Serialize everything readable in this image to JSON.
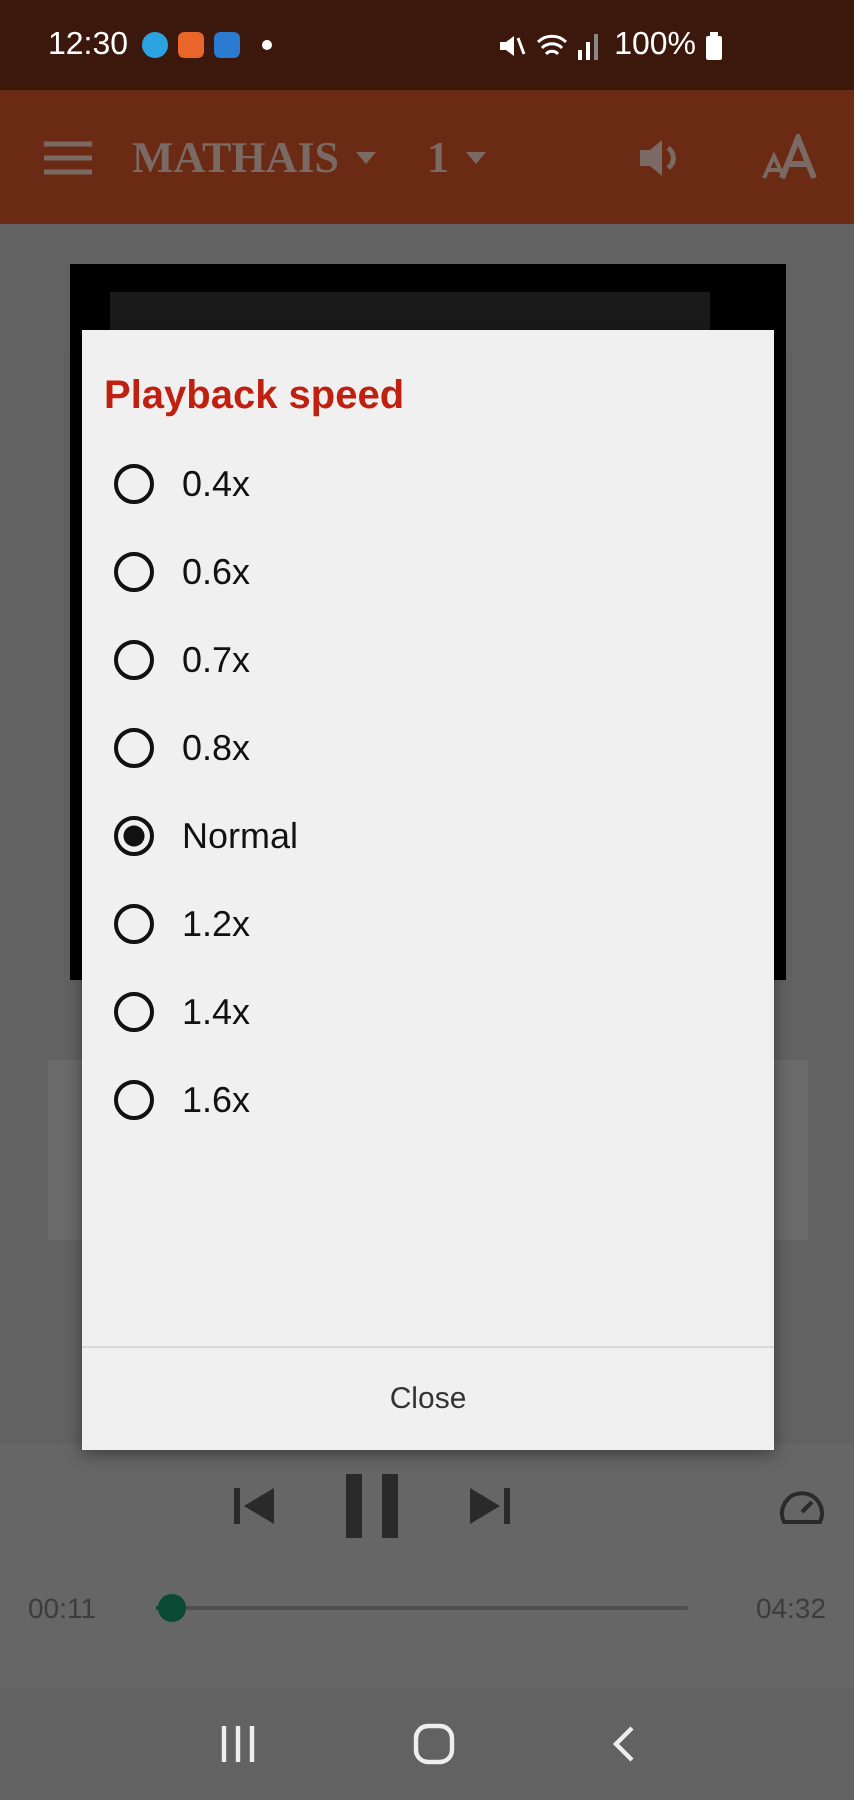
{
  "status_bar": {
    "time": "12:30",
    "battery": "100%"
  },
  "app_bar": {
    "book": "MATHAIS",
    "chapter": "1"
  },
  "dialog": {
    "title": "Playback speed",
    "options": [
      {
        "label": "0.4x",
        "selected": false
      },
      {
        "label": "0.6x",
        "selected": false
      },
      {
        "label": "0.7x",
        "selected": false
      },
      {
        "label": "0.8x",
        "selected": false
      },
      {
        "label": "Normal",
        "selected": true
      },
      {
        "label": "1.2x",
        "selected": false
      },
      {
        "label": "1.4x",
        "selected": false
      },
      {
        "label": "1.6x",
        "selected": false
      }
    ],
    "button": "Close"
  },
  "player": {
    "elapsed": "00:11",
    "total": "04:32",
    "level": 0.03
  }
}
